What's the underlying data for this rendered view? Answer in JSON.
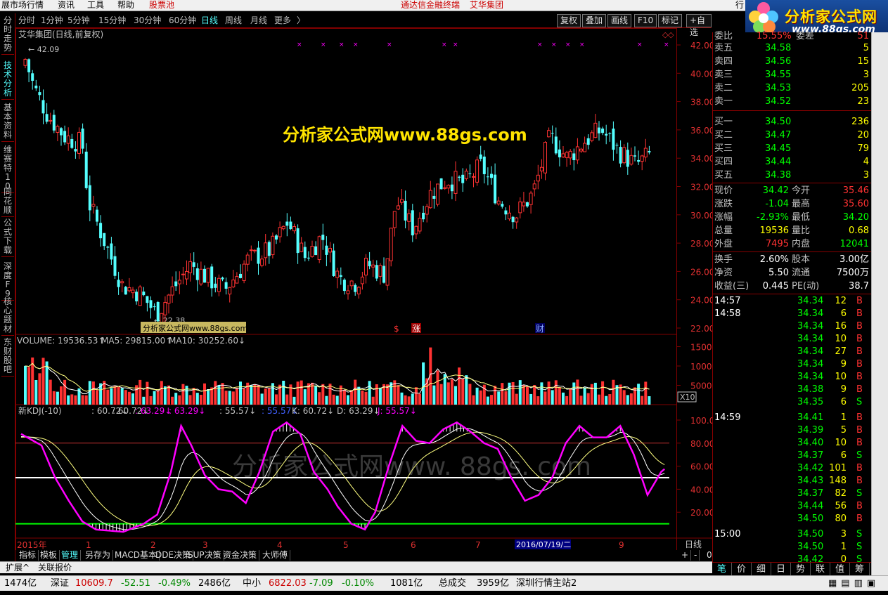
{
  "topmenu": {
    "market": "展市场行情",
    "info": "资讯",
    "tools": "工具",
    "help": "帮助",
    "pool": "股票池",
    "center_a": "通达信金融终端",
    "center_b": "艾华集团",
    "right": "行"
  },
  "logo": {
    "title": "分析家公式网",
    "url": "www.88gs.com"
  },
  "periods": [
    "分时",
    "1分钟",
    "5分钟",
    "15分钟",
    "30分钟",
    "60分钟",
    "日线",
    "周线",
    "月线",
    "更多",
    "〉"
  ],
  "toolbar": [
    "复权",
    "叠加",
    "画线",
    "F10",
    "标记",
    "+自选"
  ],
  "lefttabs": [
    "分时走势",
    "技术分析",
    "基本资料",
    "维赛特10",
    "同花顺",
    "公式下载",
    "深度F9",
    "核心题材",
    "东财股吧"
  ],
  "chart": {
    "title": "艾华集团(日线,前复权)",
    "high_label": "42.09",
    "low_label": "22.38",
    "watermark": "分析家公式网www.88gs.com",
    "watermark2": "分析家公式网www.88gs.com",
    "watermark3": "分析家公式网www. 88gs. com",
    "yaxis": [
      "42.00",
      "40.00",
      "38.00",
      "36.00",
      "34.00",
      "32.00",
      "30.00",
      "28.00",
      "26.00",
      "24.00",
      "22.00"
    ],
    "markers": [
      "$",
      "涨",
      "财"
    ],
    "volume_label": "VOLUME: 19536.53",
    "ma5_label": "MA5: 29815.00",
    "ma10_label": "MA10: 30252.60",
    "vol_axis": [
      "15000",
      "10000",
      "5000"
    ],
    "vol_unit": "X10",
    "kdj_label": "新KDJ(-10)",
    "kdj_vals": [
      ": 60.72",
      ": 60.72",
      ": 63.29",
      ": 63.29",
      ": 55.57",
      ": 55.57",
      "K: 60.72",
      "D: 63.29",
      "J: 55.57"
    ],
    "kdj_axis": [
      "100.0",
      "80.00",
      "60.00",
      "40.00",
      "20.00"
    ],
    "xaxis": [
      "2015年",
      "1",
      "2",
      "3",
      "4",
      "5",
      "6",
      "7",
      "9"
    ],
    "date_highlight": "2016/07/19/二",
    "period_label": "日线"
  },
  "bottomtabs": [
    "指标",
    "模板",
    "管理",
    "另存为",
    "MACD基本",
    "DDE决策",
    "SUP决策",
    "资金决策",
    "大师傅"
  ],
  "bottom_controls": [
    "+",
    "-",
    "0"
  ],
  "extbar": [
    "扩展^",
    "关联报价"
  ],
  "quote": {
    "weibi": "委比",
    "weibi_val": "15.55%",
    "weicha": "委差",
    "weicha_val": "51",
    "sells": [
      [
        "卖五",
        "34.58",
        "5"
      ],
      [
        "卖四",
        "34.56",
        "15"
      ],
      [
        "卖三",
        "34.55",
        "3"
      ],
      [
        "卖二",
        "34.53",
        "205"
      ],
      [
        "卖一",
        "34.52",
        "23"
      ]
    ],
    "buys": [
      [
        "买一",
        "34.50",
        "236"
      ],
      [
        "买二",
        "34.47",
        "20"
      ],
      [
        "买三",
        "34.45",
        "79"
      ],
      [
        "买四",
        "34.44",
        "4"
      ],
      [
        "买五",
        "34.38",
        "3"
      ]
    ],
    "stats": [
      [
        "现价",
        "34.42",
        "今开",
        "35.46"
      ],
      [
        "涨跌",
        "-1.04",
        "最高",
        "35.60"
      ],
      [
        "涨幅",
        "-2.93%",
        "最低",
        "34.20"
      ],
      [
        "总量",
        "19536",
        "量比",
        "0.68"
      ],
      [
        "外盘",
        "7495",
        "内盘",
        "12041"
      ]
    ],
    "stats2": [
      [
        "换手",
        "2.60%",
        "股本",
        "3.00亿"
      ],
      [
        "净资",
        "5.50",
        "流通",
        "7500万"
      ],
      [
        "收益(三)",
        "0.445",
        "PE(动)",
        "38.7"
      ]
    ],
    "ticks": [
      [
        "14:57",
        "34.34",
        "12",
        "B"
      ],
      [
        "14:58",
        "34.34",
        "6",
        "B"
      ],
      [
        "",
        "34.34",
        "16",
        "B"
      ],
      [
        "",
        "34.34",
        "10",
        "B"
      ],
      [
        "",
        "34.34",
        "27",
        "B"
      ],
      [
        "",
        "34.34",
        "9",
        "B"
      ],
      [
        "",
        "34.34",
        "10",
        "B"
      ],
      [
        "",
        "34.38",
        "9",
        "B"
      ],
      [
        "",
        "34.35",
        "6",
        "S"
      ],
      [
        "14:59",
        "34.41",
        "1",
        "B"
      ],
      [
        "",
        "34.39",
        "5",
        "B"
      ],
      [
        "",
        "34.40",
        "10",
        "B"
      ],
      [
        "",
        "34.37",
        "6",
        "S"
      ],
      [
        "",
        "34.42",
        "101",
        "B"
      ],
      [
        "",
        "34.43",
        "148",
        "B"
      ],
      [
        "",
        "34.37",
        "82",
        "S"
      ],
      [
        "",
        "34.44",
        "56",
        "B"
      ],
      [
        "",
        "34.50",
        "80",
        "B"
      ],
      [
        "15:00",
        "34.50",
        "3",
        "S"
      ],
      [
        "",
        "34.50",
        "1",
        "S"
      ],
      [
        "",
        "34.42",
        "0",
        "S"
      ]
    ]
  },
  "rtabs": [
    "笔",
    "价",
    "细",
    "日",
    "势",
    "联",
    "值",
    "筹"
  ],
  "status": {
    "a": "1474亿",
    "b": "深证",
    "c": "10609.7",
    "d": "-52.51",
    "e": "-0.49%",
    "f": "2486亿",
    "g": "中小",
    "h": "6822.03",
    "i": "-7.09",
    "j": "-0.10%",
    "k": "1081亿",
    "l": "总成交",
    "m": "3959亿",
    "n": "深圳行情主站2"
  },
  "colors": {
    "up": "#ff3232",
    "down": "#54ffff",
    "kline_down": "#54ffff",
    "k_line": "#ffffff",
    "d_line": "#ffff80",
    "j_line": "#ff00ff",
    "frame": "#800000"
  }
}
